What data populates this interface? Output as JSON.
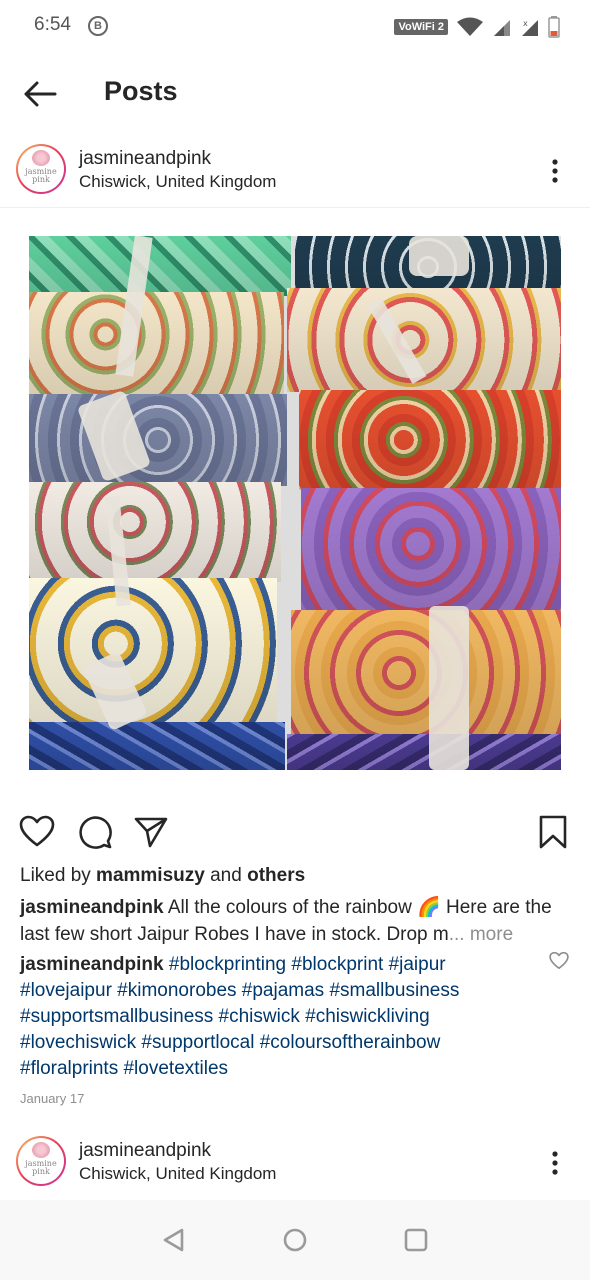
{
  "status": {
    "time": "6:54",
    "badge": "B",
    "vowifi": "VoWiFi 2"
  },
  "app_bar": {
    "title": "Posts",
    "back_icon": "back-arrow-icon"
  },
  "post": {
    "username": "jasmineandpink",
    "location": "Chiswick, United Kingdom",
    "avatar_text_line1": "jasmine",
    "avatar_text_line2": "pink",
    "liked_prefix": "Liked by ",
    "liked_user": "mammisuzy",
    "liked_mid": " and ",
    "liked_others": "others",
    "caption_user": "jasmineandpink",
    "caption_text": " All the colours of the rainbow 🌈 Here are the last few short Jaipur Robes I have in stock. Drop m",
    "caption_more": "... more",
    "comment_user": "jasmineandpink",
    "comment_tags": " #blockprinting #blockprint #jaipur #lovejaipur #kimonorobes #pajamas #smallbusiness #supportsmallbusiness #chiswick #chiswickliving #lovechiswick #supportlocal #coloursoftherainbow #floralprints #lovetextiles",
    "date": "January 17"
  },
  "next_post": {
    "username": "jasmineandpink",
    "location": "Chiswick, United Kingdom"
  },
  "colors": {
    "text": "#262626",
    "link": "#00376b",
    "muted": "#8e8e8e"
  }
}
